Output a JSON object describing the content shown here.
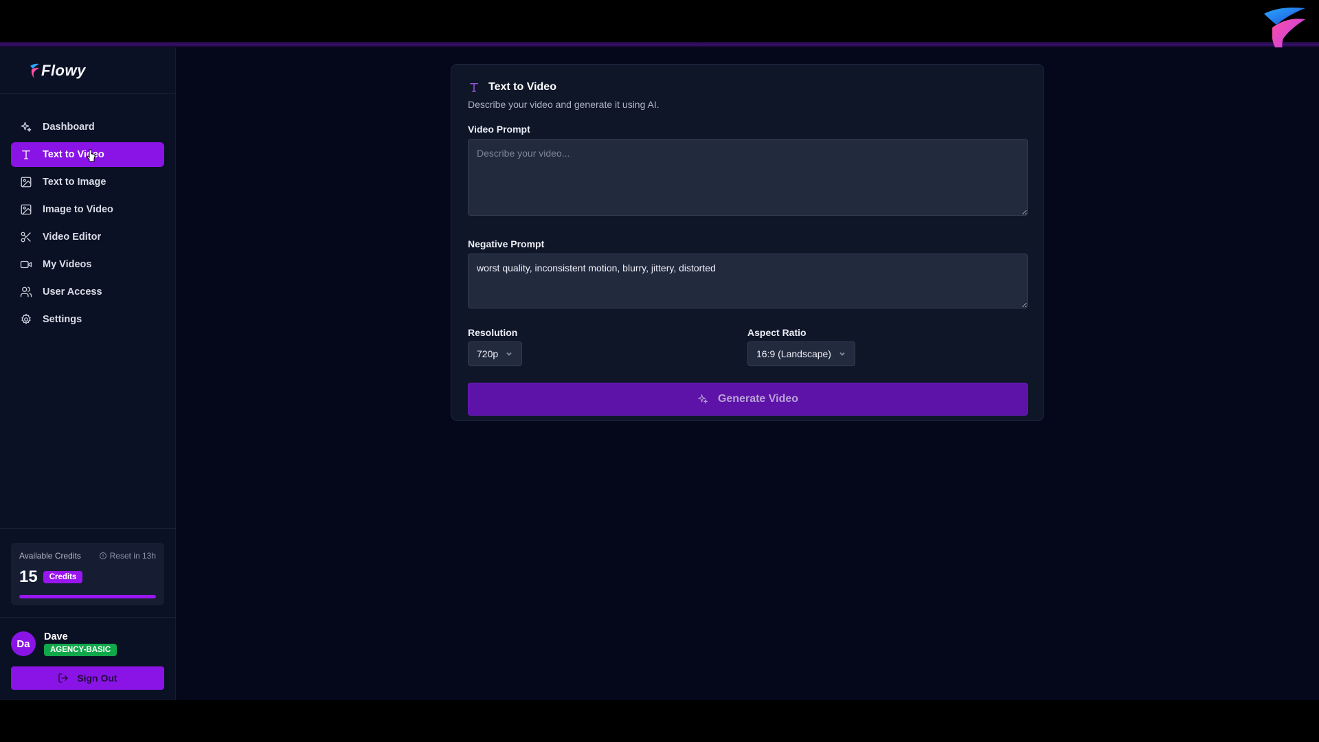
{
  "app": {
    "brand": "Flowy"
  },
  "colors": {
    "accent": "#8a14e6",
    "plan": "#10a84a",
    "background": "#05081a"
  },
  "sidebar": {
    "items": [
      {
        "label": "Dashboard",
        "icon": "sparkles-icon",
        "active": false
      },
      {
        "label": "Text to Video",
        "icon": "text-icon",
        "active": true
      },
      {
        "label": "Text to Image",
        "icon": "image-icon",
        "active": false
      },
      {
        "label": "Image to Video",
        "icon": "image-icon",
        "active": false
      },
      {
        "label": "Video Editor",
        "icon": "scissors-icon",
        "active": false
      },
      {
        "label": "My Videos",
        "icon": "video-camera-icon",
        "active": false
      },
      {
        "label": "User Access",
        "icon": "users-icon",
        "active": false
      },
      {
        "label": "Settings",
        "icon": "gear-icon",
        "active": false
      }
    ]
  },
  "credits": {
    "label": "Available Credits",
    "reset": "Reset in 13h",
    "count": "15",
    "badge": "Credits",
    "fill_fraction": 1.0
  },
  "user": {
    "initials": "Da",
    "name": "Dave",
    "plan": "AGENCY-BASIC",
    "sign_out": "Sign Out"
  },
  "panel": {
    "title": "Text to Video",
    "subtitle": "Describe your video and generate it using AI.",
    "video_prompt": {
      "label": "Video Prompt",
      "placeholder": "Describe your video...",
      "value": ""
    },
    "negative_prompt": {
      "label": "Negative Prompt",
      "value": "worst quality, inconsistent motion, blurry, jittery, distorted"
    },
    "resolution": {
      "label": "Resolution",
      "value": "720p"
    },
    "aspect_ratio": {
      "label": "Aspect Ratio",
      "value": "16:9 (Landscape)"
    },
    "generate": "Generate Video"
  }
}
